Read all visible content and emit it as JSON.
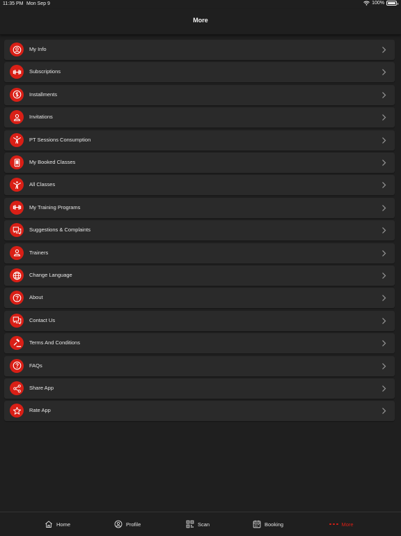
{
  "status": {
    "time": "11:35 PM",
    "date": "Mon Sep 9",
    "battery": "100%",
    "battery_level": 1.0
  },
  "header": {
    "title": "More"
  },
  "menu": [
    {
      "label": "My Info",
      "icon": "user-circle-icon"
    },
    {
      "label": "Subscriptions",
      "icon": "dumbbell-icon"
    },
    {
      "label": "Installments",
      "icon": "dollar-icon"
    },
    {
      "label": "Invitations",
      "icon": "user-icon"
    },
    {
      "label": "PT Sessions Consumption",
      "icon": "fitness-figure-icon"
    },
    {
      "label": "My Booked Classes",
      "icon": "phone-icon"
    },
    {
      "label": "All Classes",
      "icon": "fitness-figure-icon"
    },
    {
      "label": "My Training Programs",
      "icon": "dumbbell-icon"
    },
    {
      "label": "Suggestions & Complaints",
      "icon": "chat-icon"
    },
    {
      "label": "Trainers",
      "icon": "user-icon"
    },
    {
      "label": "Change Language",
      "icon": "globe-icon"
    },
    {
      "label": "About",
      "icon": "question-icon"
    },
    {
      "label": "Contact Us",
      "icon": "chat-icon"
    },
    {
      "label": "Terms And Conditions",
      "icon": "gavel-icon"
    },
    {
      "label": "FAQs",
      "icon": "question-icon"
    },
    {
      "label": "Share App",
      "icon": "share-icon"
    },
    {
      "label": "Rate App",
      "icon": "star-icon"
    }
  ],
  "tabs": [
    {
      "label": "Home",
      "icon": "home-icon"
    },
    {
      "label": "Profile",
      "icon": "profile-icon"
    },
    {
      "label": "Scan",
      "icon": "qr-icon"
    },
    {
      "label": "Booking",
      "icon": "calendar-icon"
    },
    {
      "label": "More",
      "icon": "more-dots-icon",
      "active": true
    }
  ],
  "colors": {
    "accent": "#d91f16",
    "background": "#1f1f1f",
    "card": "#2a2a2a"
  }
}
